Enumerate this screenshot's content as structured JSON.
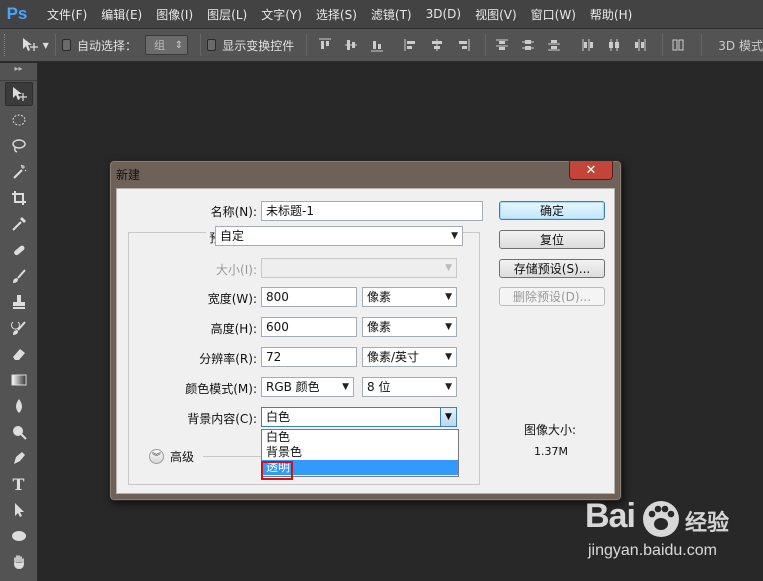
{
  "app": {
    "logo": "Ps"
  },
  "menu": [
    "文件(F)",
    "编辑(E)",
    "图像(I)",
    "图层(L)",
    "文字(Y)",
    "选择(S)",
    "滤镜(T)",
    "3D(D)",
    "视图(V)",
    "窗口(W)",
    "帮助(H)"
  ],
  "options": {
    "auto_select_label": "自动选择：",
    "auto_select_value": "组",
    "show_transform_label": "显示变换控件",
    "mode_3d_label": "3D 模式"
  },
  "tools": [
    "move-tool",
    "marquee-tool",
    "lasso-tool",
    "magic-wand-tool",
    "crop-tool",
    "eyedropper-tool",
    "healing-brush-tool",
    "brush-tool",
    "clone-stamp-tool",
    "history-brush-tool",
    "eraser-tool",
    "gradient-tool",
    "blur-tool",
    "dodge-tool",
    "pen-tool",
    "type-tool",
    "path-selection-tool",
    "shape-tool",
    "hand-tool"
  ],
  "dialog": {
    "title": "新建",
    "close_symbol": "✕",
    "name_label": "名称(N):",
    "name_value": "未标题-1",
    "preset_label": "预设(P):",
    "preset_value": "自定",
    "size_label": "大小(I):",
    "size_value": "",
    "width_label": "宽度(W):",
    "width_value": "800",
    "width_unit": "像素",
    "height_label": "高度(H):",
    "height_value": "600",
    "height_unit": "像素",
    "resolution_label": "分辨率(R):",
    "resolution_value": "72",
    "resolution_unit": "像素/英寸",
    "color_mode_label": "颜色模式(M):",
    "color_mode_value": "RGB 颜色",
    "bit_depth_value": "8 位",
    "background_label": "背景内容(C):",
    "background_value": "白色",
    "background_options": [
      "白色",
      "背景色",
      "透明"
    ],
    "background_highlighted": "透明",
    "advanced_label": "高级",
    "image_size_label": "图像大小:",
    "image_size_value": "1.37M",
    "buttons": {
      "ok": "确定",
      "reset": "复位",
      "save_preset": "存储预设(S)...",
      "delete_preset": "删除预设(D)..."
    }
  },
  "watermark": {
    "logo_text": "Bai",
    "cn_text": "经验",
    "url": "jingyan.baidu.com"
  }
}
